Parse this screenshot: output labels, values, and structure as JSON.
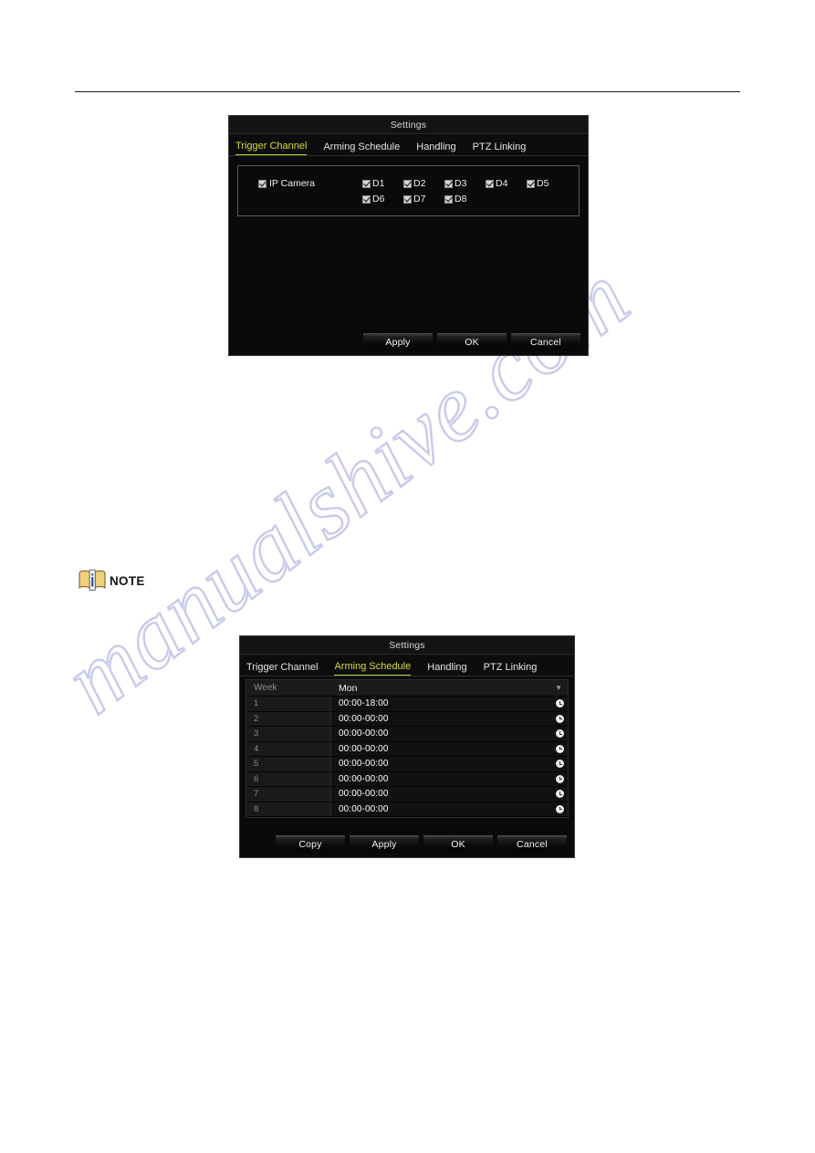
{
  "watermark": {
    "text": "manualshive.com"
  },
  "note": {
    "label": "NOTE",
    "icon": "book-info-icon"
  },
  "dialog_trigger_channel": {
    "title": "Settings",
    "tabs": [
      {
        "label": "Trigger Channel",
        "active": true
      },
      {
        "label": "Arming Schedule",
        "active": false
      },
      {
        "label": "Handling",
        "active": false
      },
      {
        "label": "PTZ Linking",
        "active": false
      }
    ],
    "ip_camera": {
      "label": "IP Camera",
      "checked": true
    },
    "channels": [
      {
        "label": "D1",
        "checked": true
      },
      {
        "label": "D2",
        "checked": true
      },
      {
        "label": "D3",
        "checked": true
      },
      {
        "label": "D4",
        "checked": true
      },
      {
        "label": "D5",
        "checked": true
      },
      {
        "label": "D6",
        "checked": true
      },
      {
        "label": "D7",
        "checked": true
      },
      {
        "label": "D8",
        "checked": true
      }
    ],
    "buttons": [
      {
        "label": "Apply"
      },
      {
        "label": "OK"
      },
      {
        "label": "Cancel"
      }
    ]
  },
  "dialog_arming_schedule": {
    "title": "Settings",
    "tabs": [
      {
        "label": "Trigger Channel",
        "active": false
      },
      {
        "label": "Arming Schedule",
        "active": true
      },
      {
        "label": "Handling",
        "active": false
      },
      {
        "label": "PTZ Linking",
        "active": false
      }
    ],
    "week": {
      "label": "Week",
      "value": "Mon",
      "caret": "chevron-down-icon"
    },
    "rows": [
      {
        "num": "1",
        "time": "00:00-18:00"
      },
      {
        "num": "2",
        "time": "00:00-00:00"
      },
      {
        "num": "3",
        "time": "00:00-00:00"
      },
      {
        "num": "4",
        "time": "00:00-00:00"
      },
      {
        "num": "5",
        "time": "00:00-00:00"
      },
      {
        "num": "6",
        "time": "00:00-00:00"
      },
      {
        "num": "7",
        "time": "00:00-00:00"
      },
      {
        "num": "8",
        "time": "00:00-00:00"
      }
    ],
    "buttons": [
      {
        "label": "Copy"
      },
      {
        "label": "Apply"
      },
      {
        "label": "OK"
      },
      {
        "label": "Cancel"
      }
    ]
  },
  "colors": {
    "accent_tab": "#d7d943",
    "dialog_bg": "#0a0a0a",
    "watermark": "#c9caea"
  }
}
